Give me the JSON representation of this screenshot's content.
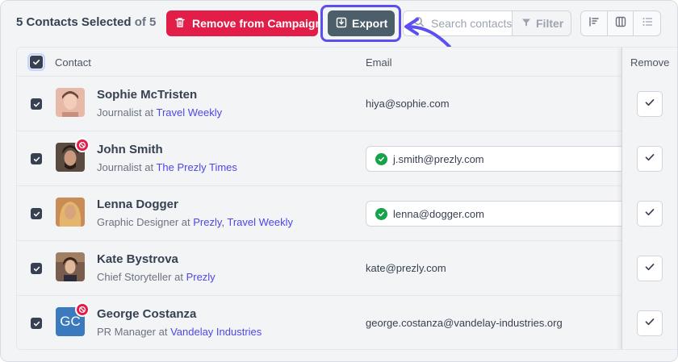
{
  "toolbar": {
    "selected_count_text": "5 Contacts Selected",
    "of_total_text": "of 5",
    "remove_label": "Remove from Campaign",
    "export_label": "Export",
    "search_placeholder": "Search contacts",
    "filter_label": "Filter"
  },
  "table": {
    "headers": {
      "contact": "Contact",
      "email": "Email",
      "remove": "Remove"
    },
    "rows": [
      {
        "name": "Sophie McTristen",
        "role_prefix": "Journalist at",
        "orgs": "Travel Weekly",
        "email": "hiya@sophie.com",
        "email_verified": false,
        "blocked": false
      },
      {
        "name": "John Smith",
        "role_prefix": "Journalist at",
        "orgs": "The Prezly Times",
        "email": "j.smith@prezly.com",
        "email_verified": true,
        "blocked": true
      },
      {
        "name": "Lenna Dogger",
        "role_prefix": "Graphic Designer at",
        "orgs": "Prezly, Travel Weekly",
        "email": "lenna@dogger.com",
        "email_verified": true,
        "blocked": false
      },
      {
        "name": "Kate Bystrova",
        "role_prefix": "Chief Storyteller at",
        "orgs": "Prezly",
        "email": "kate@prezly.com",
        "email_verified": false,
        "blocked": false
      },
      {
        "name": "George Costanza",
        "role_prefix": "PR Manager at",
        "orgs": "Vandelay Industries",
        "email": "george.costanza@vandelay-industries.org",
        "email_verified": false,
        "blocked": true,
        "initials": "GC"
      }
    ]
  },
  "colors": {
    "danger": "#e11d48",
    "export": "#4b5e6a",
    "highlight": "#5b4ff0",
    "link": "#4f46e5",
    "verified": "#16a34a"
  }
}
